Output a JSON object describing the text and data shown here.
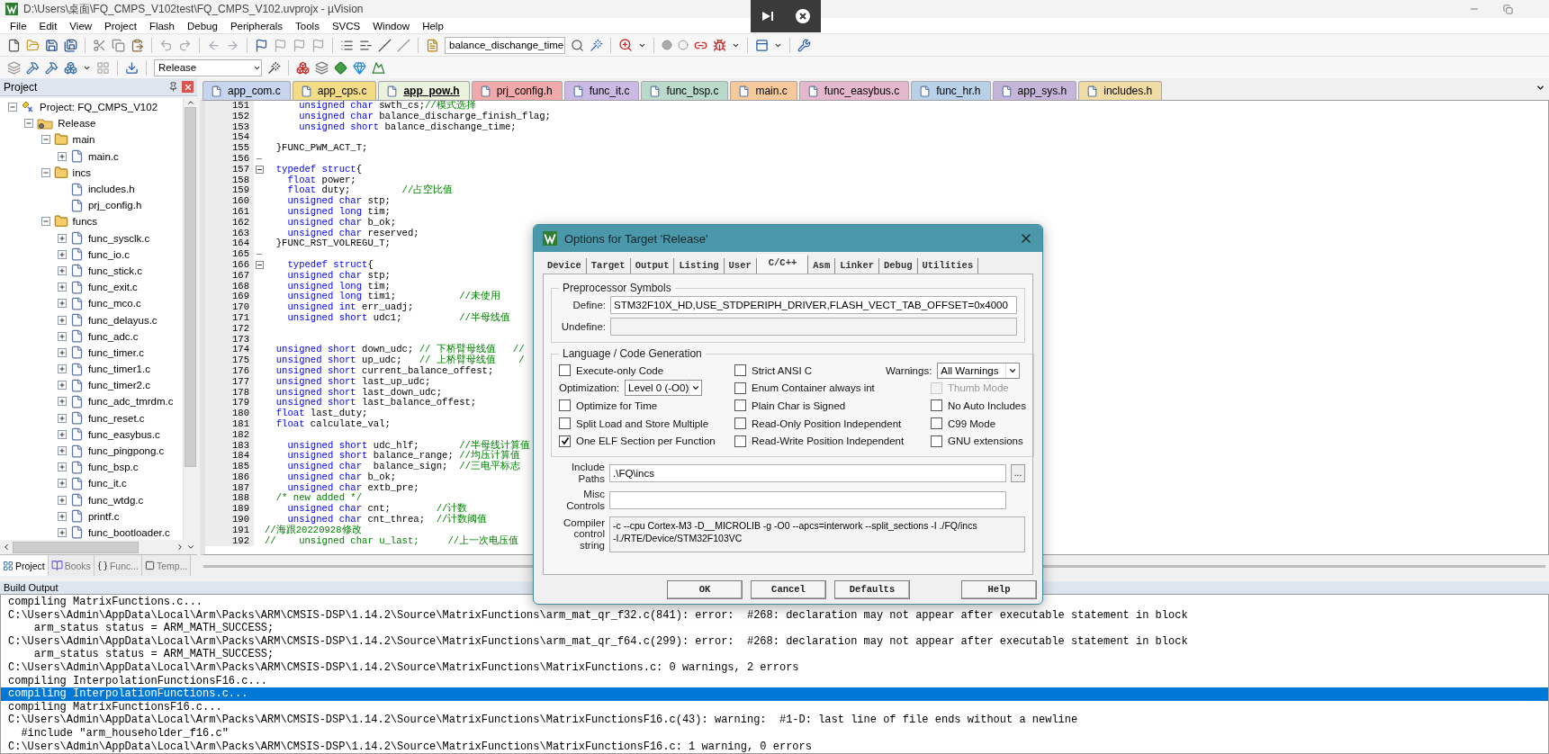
{
  "window": {
    "title": "D:\\Users\\桌面\\FQ_CMPS_V102test\\FQ_CMPS_V102.uvprojx - µVision"
  },
  "menu": [
    "File",
    "Edit",
    "View",
    "Project",
    "Flash",
    "Debug",
    "Peripherals",
    "Tools",
    "SVCS",
    "Window",
    "Help"
  ],
  "toolbar": {
    "find_combo": "balance_dischange_time",
    "target_combo": "Release"
  },
  "project_panel": {
    "title": "Project",
    "tree": [
      {
        "label": "Project: FQ_CMPS_V102",
        "kind": "project",
        "expanded": true,
        "children": [
          {
            "label": "Release",
            "kind": "target",
            "expanded": true,
            "children": [
              {
                "label": "main",
                "kind": "folder",
                "expanded": true,
                "children": [
                  {
                    "label": "main.c",
                    "kind": "file",
                    "expanded": false
                  }
                ]
              },
              {
                "label": "incs",
                "kind": "folder",
                "expanded": true,
                "children": [
                  {
                    "label": "includes.h",
                    "kind": "file"
                  },
                  {
                    "label": "prj_config.h",
                    "kind": "file"
                  }
                ]
              },
              {
                "label": "funcs",
                "kind": "folder",
                "expanded": true,
                "children": [
                  {
                    "label": "func_sysclk.c",
                    "kind": "file",
                    "expanded": false
                  },
                  {
                    "label": "func_io.c",
                    "kind": "file",
                    "expanded": false
                  },
                  {
                    "label": "func_stick.c",
                    "kind": "file",
                    "expanded": false
                  },
                  {
                    "label": "func_exit.c",
                    "kind": "file",
                    "expanded": false
                  },
                  {
                    "label": "func_mco.c",
                    "kind": "file",
                    "expanded": false
                  },
                  {
                    "label": "func_delayus.c",
                    "kind": "file",
                    "expanded": false
                  },
                  {
                    "label": "func_adc.c",
                    "kind": "file",
                    "expanded": false
                  },
                  {
                    "label": "func_timer.c",
                    "kind": "file",
                    "expanded": false
                  },
                  {
                    "label": "func_timer1.c",
                    "kind": "file",
                    "expanded": false
                  },
                  {
                    "label": "func_timer2.c",
                    "kind": "file",
                    "expanded": false
                  },
                  {
                    "label": "func_adc_tmrdm.c",
                    "kind": "file",
                    "expanded": false
                  },
                  {
                    "label": "func_reset.c",
                    "kind": "file",
                    "expanded": false
                  },
                  {
                    "label": "func_easybus.c",
                    "kind": "file",
                    "expanded": false
                  },
                  {
                    "label": "func_pingpong.c",
                    "kind": "file",
                    "expanded": false
                  },
                  {
                    "label": "func_bsp.c",
                    "kind": "file",
                    "expanded": false
                  },
                  {
                    "label": "func_it.c",
                    "kind": "file",
                    "expanded": false
                  },
                  {
                    "label": "func_wtdg.c",
                    "kind": "file",
                    "expanded": false
                  },
                  {
                    "label": "printf.c",
                    "kind": "file",
                    "expanded": false
                  },
                  {
                    "label": "func_bootloader.c",
                    "kind": "file",
                    "expanded": false
                  }
                ]
              }
            ]
          }
        ]
      }
    ],
    "tabs": [
      {
        "label": "Project",
        "kind": "project",
        "selected": true
      },
      {
        "label": "Books",
        "kind": "books",
        "selected": false
      },
      {
        "label": "Func...",
        "kind": "functions",
        "selected": false
      },
      {
        "label": "Temp...",
        "kind": "templates",
        "selected": false
      }
    ]
  },
  "editor": {
    "tabs": [
      {
        "label": "app_com.c",
        "color": "#c8d5ef",
        "selected": false
      },
      {
        "label": "app_cps.c",
        "color": "#f3dc86",
        "selected": false
      },
      {
        "label": "app_pow.h",
        "color": "#eaf1dc",
        "selected": true
      },
      {
        "label": "prj_config.h",
        "color": "#f1a9a9",
        "selected": false
      },
      {
        "label": "func_it.c",
        "color": "#cbbbe4",
        "selected": false
      },
      {
        "label": "func_bsp.c",
        "color": "#b9d9ca",
        "selected": false
      },
      {
        "label": "main.c",
        "color": "#f5c99c",
        "selected": false
      },
      {
        "label": "func_easybus.c",
        "color": "#e6b8cd",
        "selected": false
      },
      {
        "label": "func_hr.h",
        "color": "#b8d0e8",
        "selected": false
      },
      {
        "label": "app_sys.h",
        "color": "#c5b6d9",
        "selected": false
      },
      {
        "label": "includes.h",
        "color": "#f0dca4",
        "selected": false
      }
    ],
    "lines": [
      {
        "number": "151",
        "segments": [
          {
            "kind": "keyword",
            "text": "      unsigned char"
          },
          {
            "kind": "plain",
            "text": " swth_cs;"
          },
          {
            "kind": "comment",
            "text": "//模式选择"
          }
        ]
      },
      {
        "number": "152",
        "segments": [
          {
            "kind": "keyword",
            "text": "      unsigned char"
          },
          {
            "kind": "plain",
            "text": " balance_discharge_finish_flag;"
          }
        ]
      },
      {
        "number": "153",
        "segments": [
          {
            "kind": "keyword",
            "text": "      unsigned short"
          },
          {
            "kind": "plain",
            "text": " balance_dischange_time;"
          }
        ]
      },
      {
        "number": "154"
      },
      {
        "number": "155",
        "segments": [
          {
            "kind": "plain",
            "text": "  }FUNC_PWM_ACT_T;"
          }
        ]
      },
      {
        "number": "156",
        "fold_end": true
      },
      {
        "number": "157",
        "fold_start": true,
        "segments": [
          {
            "kind": "keyword",
            "text": "  typedef struct"
          },
          {
            "kind": "plain",
            "text": "{"
          }
        ]
      },
      {
        "number": "158",
        "segments": [
          {
            "kind": "keyword",
            "text": "    float"
          },
          {
            "kind": "plain",
            "text": " power;"
          }
        ]
      },
      {
        "number": "159",
        "segments": [
          {
            "kind": "keyword",
            "text": "    float"
          },
          {
            "kind": "plain",
            "text": " duty;         "
          },
          {
            "kind": "comment",
            "text": "//占空比值"
          }
        ]
      },
      {
        "number": "160",
        "segments": [
          {
            "kind": "keyword",
            "text": "    unsigned char"
          },
          {
            "kind": "plain",
            "text": " stp;"
          }
        ]
      },
      {
        "number": "161",
        "segments": [
          {
            "kind": "keyword",
            "text": "    unsigned long"
          },
          {
            "kind": "plain",
            "text": " tim;"
          }
        ]
      },
      {
        "number": "162",
        "segments": [
          {
            "kind": "keyword",
            "text": "    unsigned char"
          },
          {
            "kind": "plain",
            "text": " b_ok;"
          }
        ]
      },
      {
        "number": "163",
        "segments": [
          {
            "kind": "keyword",
            "text": "    unsigned char"
          },
          {
            "kind": "plain",
            "text": " reserved;"
          }
        ]
      },
      {
        "number": "164",
        "segments": [
          {
            "kind": "plain",
            "text": "  }FUNC_RST_VOLREGU_T;"
          }
        ]
      },
      {
        "number": "165",
        "fold_end": true
      },
      {
        "number": "166",
        "fold_start": true,
        "segments": [
          {
            "kind": "keyword",
            "text": "    typedef struct"
          },
          {
            "kind": "plain",
            "text": "{"
          }
        ]
      },
      {
        "number": "167",
        "segments": [
          {
            "kind": "keyword",
            "text": "    unsigned char"
          },
          {
            "kind": "plain",
            "text": " stp;"
          }
        ]
      },
      {
        "number": "168",
        "segments": [
          {
            "kind": "keyword",
            "text": "    unsigned long"
          },
          {
            "kind": "plain",
            "text": " tim;"
          }
        ]
      },
      {
        "number": "169",
        "segments": [
          {
            "kind": "keyword",
            "text": "    unsigned long"
          },
          {
            "kind": "plain",
            "text": " tim1;           "
          },
          {
            "kind": "comment",
            "text": "//未使用"
          }
        ]
      },
      {
        "number": "170",
        "segments": [
          {
            "kind": "keyword",
            "text": "    unsigned int"
          },
          {
            "kind": "plain",
            "text": " err_uadj;"
          }
        ]
      },
      {
        "number": "171",
        "segments": [
          {
            "kind": "keyword",
            "text": "    unsigned short"
          },
          {
            "kind": "plain",
            "text": " udc1;          "
          },
          {
            "kind": "comment",
            "text": "//半母线值"
          }
        ]
      },
      {
        "number": "172"
      },
      {
        "number": "173"
      },
      {
        "number": "174",
        "segments": [
          {
            "kind": "keyword",
            "text": "  unsigned short"
          },
          {
            "kind": "plain",
            "text": " down_udc; "
          },
          {
            "kind": "comment",
            "text": "// 下桥臂母线值   //"
          }
        ]
      },
      {
        "number": "175",
        "segments": [
          {
            "kind": "keyword",
            "text": "  unsigned short"
          },
          {
            "kind": "plain",
            "text": " up_udc;   "
          },
          {
            "kind": "comment",
            "text": "// 上桥臂母线值    /"
          }
        ]
      },
      {
        "number": "176",
        "segments": [
          {
            "kind": "keyword",
            "text": "  unsigned short"
          },
          {
            "kind": "plain",
            "text": " current_balance_offest;"
          }
        ]
      },
      {
        "number": "177",
        "segments": [
          {
            "kind": "keyword",
            "text": "  unsigned short"
          },
          {
            "kind": "plain",
            "text": " last_up_udc;"
          }
        ]
      },
      {
        "number": "178",
        "segments": [
          {
            "kind": "keyword",
            "text": "  unsigned short"
          },
          {
            "kind": "plain",
            "text": " last_down_udc;"
          }
        ]
      },
      {
        "number": "179",
        "segments": [
          {
            "kind": "keyword",
            "text": "  unsigned short"
          },
          {
            "kind": "plain",
            "text": " last_balance_offest;"
          }
        ]
      },
      {
        "number": "180",
        "segments": [
          {
            "kind": "keyword",
            "text": "  float"
          },
          {
            "kind": "plain",
            "text": " last_duty;"
          }
        ]
      },
      {
        "number": "181",
        "segments": [
          {
            "kind": "keyword",
            "text": "  float"
          },
          {
            "kind": "plain",
            "text": " calculate_val;"
          }
        ]
      },
      {
        "number": "182"
      },
      {
        "number": "183",
        "segments": [
          {
            "kind": "keyword",
            "text": "    unsigned short"
          },
          {
            "kind": "plain",
            "text": " udc_hlf;       "
          },
          {
            "kind": "comment",
            "text": "//半母线计算值"
          }
        ]
      },
      {
        "number": "184",
        "segments": [
          {
            "kind": "keyword",
            "text": "    unsigned short"
          },
          {
            "kind": "plain",
            "text": " balance_range; "
          },
          {
            "kind": "comment",
            "text": "//均压计算值"
          }
        ]
      },
      {
        "number": "185",
        "segments": [
          {
            "kind": "keyword",
            "text": "    unsigned char"
          },
          {
            "kind": "plain",
            "text": "  balance_sign;  "
          },
          {
            "kind": "comment",
            "text": "//三电平标志"
          }
        ]
      },
      {
        "number": "186",
        "segments": [
          {
            "kind": "keyword",
            "text": "    unsigned char"
          },
          {
            "kind": "plain",
            "text": " b_ok;"
          }
        ]
      },
      {
        "number": "187",
        "segments": [
          {
            "kind": "keyword",
            "text": "    unsigned char"
          },
          {
            "kind": "plain",
            "text": " extb_pre;"
          }
        ]
      },
      {
        "number": "188",
        "segments": [
          {
            "kind": "comment",
            "text": "  /* new added */"
          }
        ]
      },
      {
        "number": "189",
        "segments": [
          {
            "kind": "keyword",
            "text": "    unsigned char"
          },
          {
            "kind": "plain",
            "text": " cnt;        "
          },
          {
            "kind": "comment",
            "text": "//计数"
          }
        ]
      },
      {
        "number": "190",
        "segments": [
          {
            "kind": "keyword",
            "text": "    unsigned char"
          },
          {
            "kind": "plain",
            "text": " cnt_threa;  "
          },
          {
            "kind": "comment",
            "text": "//计数阈值"
          }
        ]
      },
      {
        "number": "191",
        "segments": [
          {
            "kind": "comment",
            "text": "//海跟20220928修改"
          }
        ]
      },
      {
        "number": "192",
        "segments": [
          {
            "kind": "comment",
            "text": "//    unsigned char u_last;     //上一次电压值"
          }
        ]
      }
    ]
  },
  "build_output": {
    "title": "Build Output",
    "lines": [
      {
        "text": "compiling MatrixFunctions.c...",
        "selected": false
      },
      {
        "text": "C:\\Users\\Admin\\AppData\\Local\\Arm\\Packs\\ARM\\CMSIS-DSP\\1.14.2\\Source\\MatrixFunctions\\arm_mat_qr_f32.c(841): error:  #268: declaration may not appear after executable statement in block",
        "selected": false
      },
      {
        "text": "    arm_status status = ARM_MATH_SUCCESS;",
        "selected": false
      },
      {
        "text": "C:\\Users\\Admin\\AppData\\Local\\Arm\\Packs\\ARM\\CMSIS-DSP\\1.14.2\\Source\\MatrixFunctions\\arm_mat_qr_f64.c(299): error:  #268: declaration may not appear after executable statement in block",
        "selected": false
      },
      {
        "text": "    arm_status status = ARM_MATH_SUCCESS;",
        "selected": false
      },
      {
        "text": "C:\\Users\\Admin\\AppData\\Local\\Arm\\Packs\\ARM\\CMSIS-DSP\\1.14.2\\Source\\MatrixFunctions\\MatrixFunctions.c: 0 warnings, 2 errors",
        "selected": false
      },
      {
        "text": "compiling InterpolationFunctionsF16.c...",
        "selected": false
      },
      {
        "text": "compiling InterpolationFunctions.c...",
        "selected": true
      },
      {
        "text": "compiling MatrixFunctionsF16.c...",
        "selected": false
      },
      {
        "text": "C:\\Users\\Admin\\AppData\\Local\\Arm\\Packs\\ARM\\CMSIS-DSP\\1.14.2\\Source\\MatrixFunctions\\MatrixFunctionsF16.c(43): warning:  #1-D: last line of file ends without a newline",
        "selected": false
      },
      {
        "text": "  #include \"arm_householder_f16.c\"",
        "selected": false
      },
      {
        "text": "C:\\Users\\Admin\\AppData\\Local\\Arm\\Packs\\ARM\\CMSIS-DSP\\1.14.2\\Source\\MatrixFunctions\\MatrixFunctionsF16.c: 1 warning, 0 errors",
        "selected": false
      }
    ]
  },
  "dialog": {
    "title": "Options for Target 'Release'",
    "tabs": [
      {
        "label": "Device",
        "selected": false
      },
      {
        "label": "Target",
        "selected": false
      },
      {
        "label": "Output",
        "selected": false
      },
      {
        "label": "Listing",
        "selected": false
      },
      {
        "label": "User",
        "selected": false
      },
      {
        "label": "C/C++",
        "selected": true
      },
      {
        "label": "Asm",
        "selected": false
      },
      {
        "label": "Linker",
        "selected": false
      },
      {
        "label": "Debug",
        "selected": false
      },
      {
        "label": "Utilities",
        "selected": false
      }
    ],
    "preprocessor": {
      "title": "Preprocessor Symbols",
      "define_label": "Define:",
      "define_value": "STM32F10X_HD,USE_STDPERIPH_DRIVER,FLASH_VECT_TAB_OFFSET=0x4000",
      "undefine_label": "Undefine:"
    },
    "language": {
      "title": "Language / Code Generation",
      "columns": [
        [
          {
            "kind": "checkbox",
            "label": "Execute-only Code",
            "checked": false,
            "disabled": false
          },
          {
            "kind": "select",
            "label": "Optimization:",
            "value": "Level 0 (-O0)"
          },
          {
            "kind": "checkbox",
            "label": "Optimize for Time",
            "checked": false,
            "disabled": false
          },
          {
            "kind": "checkbox",
            "label": "Split Load and Store Multiple",
            "checked": false,
            "disabled": false
          },
          {
            "kind": "checkbox",
            "label": "One ELF Section per Function",
            "checked": true,
            "disabled": false
          }
        ],
        [
          {
            "kind": "checkbox",
            "label": "Strict ANSI C",
            "checked": false,
            "disabled": false
          },
          {
            "kind": "checkbox",
            "label": "Enum Container always int",
            "checked": false,
            "disabled": false
          },
          {
            "kind": "checkbox",
            "label": "Plain Char is Signed",
            "checked": false,
            "disabled": false
          },
          {
            "kind": "checkbox",
            "label": "Read-Only Position Independent",
            "checked": false,
            "disabled": false
          },
          {
            "kind": "checkbox",
            "label": "Read-Write Position Independent",
            "checked": false,
            "disabled": false
          }
        ],
        [
          {
            "kind": "select",
            "label": "Warnings:",
            "value": "All Warnings"
          },
          {
            "kind": "checkbox",
            "label": "Thumb Mode",
            "checked": false,
            "disabled": true
          },
          {
            "kind": "checkbox",
            "label": "No Auto Includes",
            "checked": false,
            "disabled": false
          },
          {
            "kind": "checkbox",
            "label": "C99 Mode",
            "checked": false,
            "disabled": false
          },
          {
            "kind": "checkbox",
            "label": "GNU extensions",
            "checked": false,
            "disabled": false
          }
        ]
      ]
    },
    "include_paths": {
      "label": "Include Paths",
      "value": ".\\FQ\\incs",
      "browse": "..."
    },
    "misc_controls": {
      "label": "Misc Controls"
    },
    "compiler_string": {
      "label": "Compiler control string",
      "value": "-c --cpu Cortex-M3 -D__MICROLIB -g -O0 --apcs=interwork --split_sections -I ./FQ/incs\n-I./RTE/Device/STM32F103VC"
    },
    "buttons": [
      "OK",
      "Cancel",
      "Defaults",
      "Help"
    ]
  }
}
